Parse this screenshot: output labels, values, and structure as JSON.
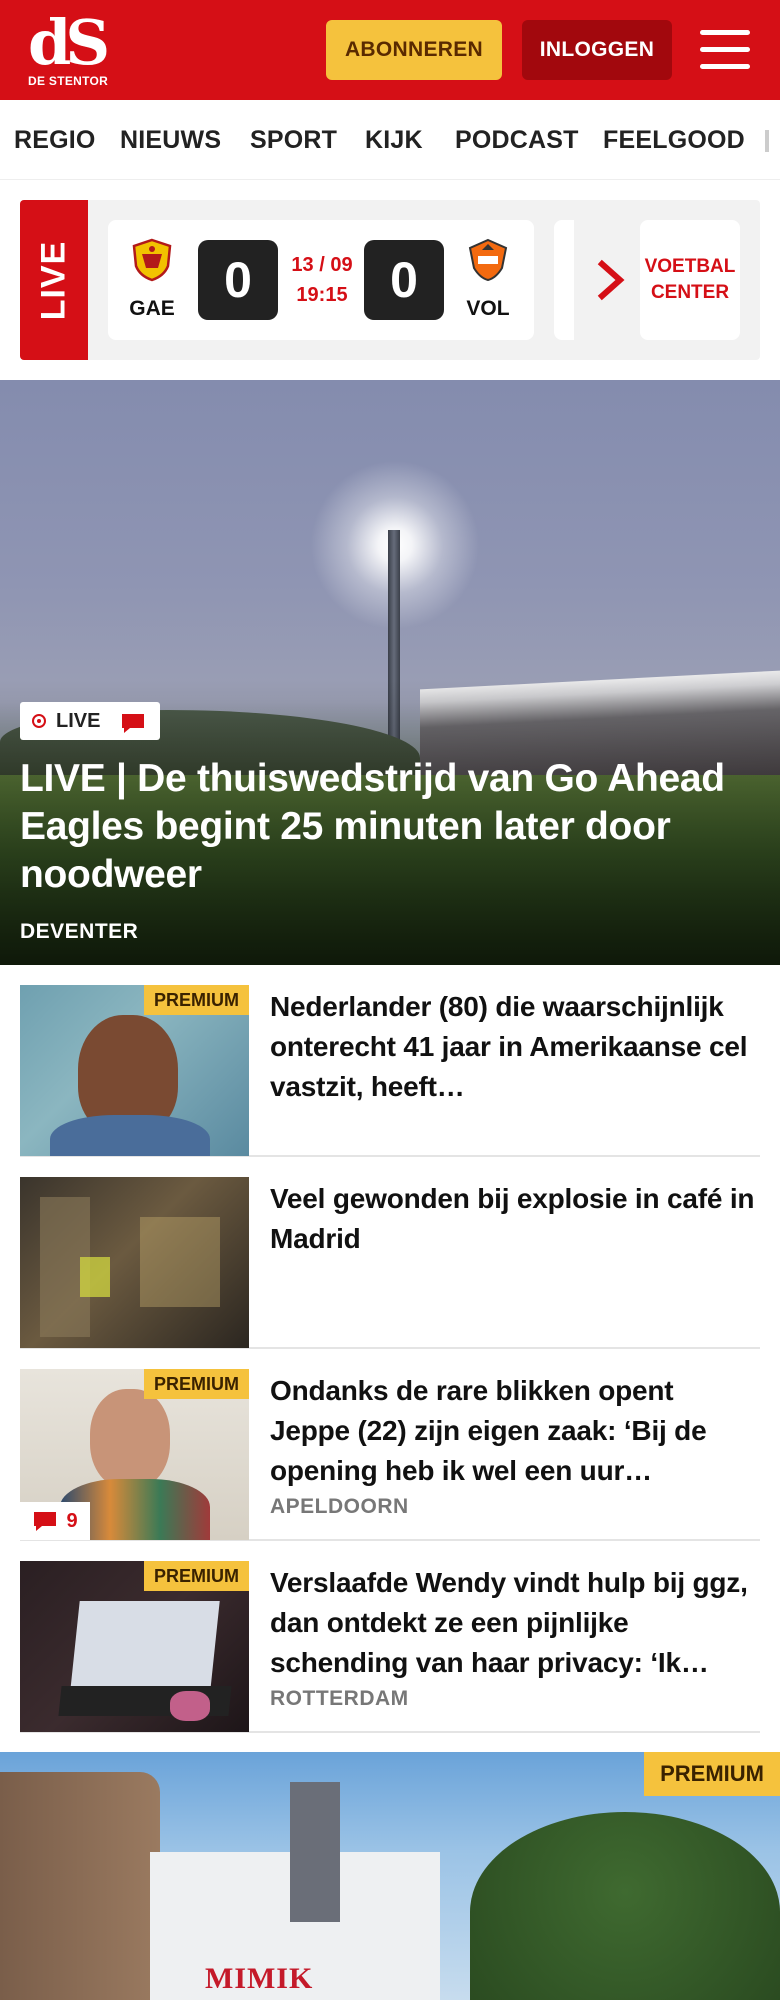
{
  "header": {
    "logo_mark": "dS",
    "logo_sub": "DE STENTOR",
    "subscribe_label": "ABONNEREN",
    "login_label": "INLOGGEN",
    "menu_icon": "hamburger-icon",
    "colors": {
      "brand": "#d50f16",
      "subscribe": "#f5c23d"
    }
  },
  "nav": {
    "items": [
      "REGIO",
      "NIEUWS",
      "SPORT",
      "KIJK",
      "PODCAST",
      "FEELGOOD"
    ]
  },
  "livebar": {
    "live_label": "LIVE",
    "match": {
      "home": "GAE",
      "away": "VOL",
      "home_score": "0",
      "away_score": "0",
      "date": "13 / 09",
      "time": "19:15"
    },
    "voetbalcenter_label": "VOETBAL CENTER"
  },
  "hero": {
    "badge": "LIVE",
    "title": "LIVE | De thuiswedstrijd van Go Ahead Eagles begint 25 minuten later door noodweer",
    "location": "DEVENTER"
  },
  "articles": [
    {
      "premium": "PREMIUM",
      "title": "Nederlander (80) die waarschijn­lijk onterecht 41 jaar in Amerikaanse cel vastzit, heeft…",
      "location": ""
    },
    {
      "premium": "",
      "title": "Veel gewonden bij explosie in café in Madrid",
      "location": ""
    },
    {
      "premium": "PREMIUM",
      "title": "Ondanks de rare blikken opent Jeppe (22) zijn eigen zaak: ‘Bij de opening heb ik wel een uur…",
      "location": "APELDOORN",
      "comments": "9"
    },
    {
      "premium": "PREMIUM",
      "title": "Verslaafde Wendy vindt hulp bij ggz, dan ontdekt ze een pijnlijke schending van haar privacy: ‘Ik…",
      "location": "ROTTERDAM"
    }
  ],
  "featured": {
    "premium": "PREMIUM",
    "sign_text": "MIMIK"
  }
}
